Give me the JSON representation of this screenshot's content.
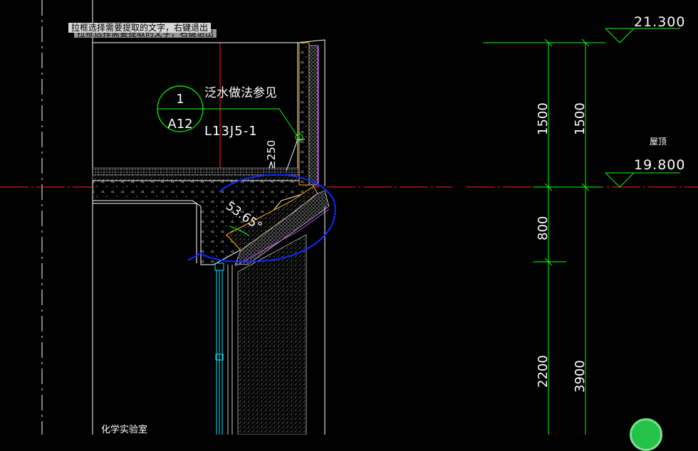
{
  "toolbar_hint": {
    "prompt_text": "拉框选择需要提取的文字，右键退出",
    "ghost_text": "拉框选择需要提取的文字，右键退出"
  },
  "detail_callout": {
    "number": "1",
    "sheet": "A12",
    "note": "泛水做法参见",
    "reference": "L13J5-1"
  },
  "annotations": {
    "min_height": "≥250",
    "angle": "53.65°",
    "room_name": "化学实验室"
  },
  "elevations": {
    "top_level": "21.300",
    "roof_label": "屋顶",
    "roof_level": "19.800"
  },
  "dimensions": {
    "inner_column": [
      "1500",
      "800",
      "2200"
    ],
    "outer_column": [
      "1500",
      "3900"
    ]
  },
  "colors": {
    "background": "#000000",
    "dimension": "#00ff00",
    "text": "#ffffff",
    "axis": "#ff0000",
    "structure": "#ffffff",
    "insulation": "#ffb000",
    "membrane": "#d050ff",
    "glazing": "#00e5ff",
    "markup": "#1028ff"
  }
}
